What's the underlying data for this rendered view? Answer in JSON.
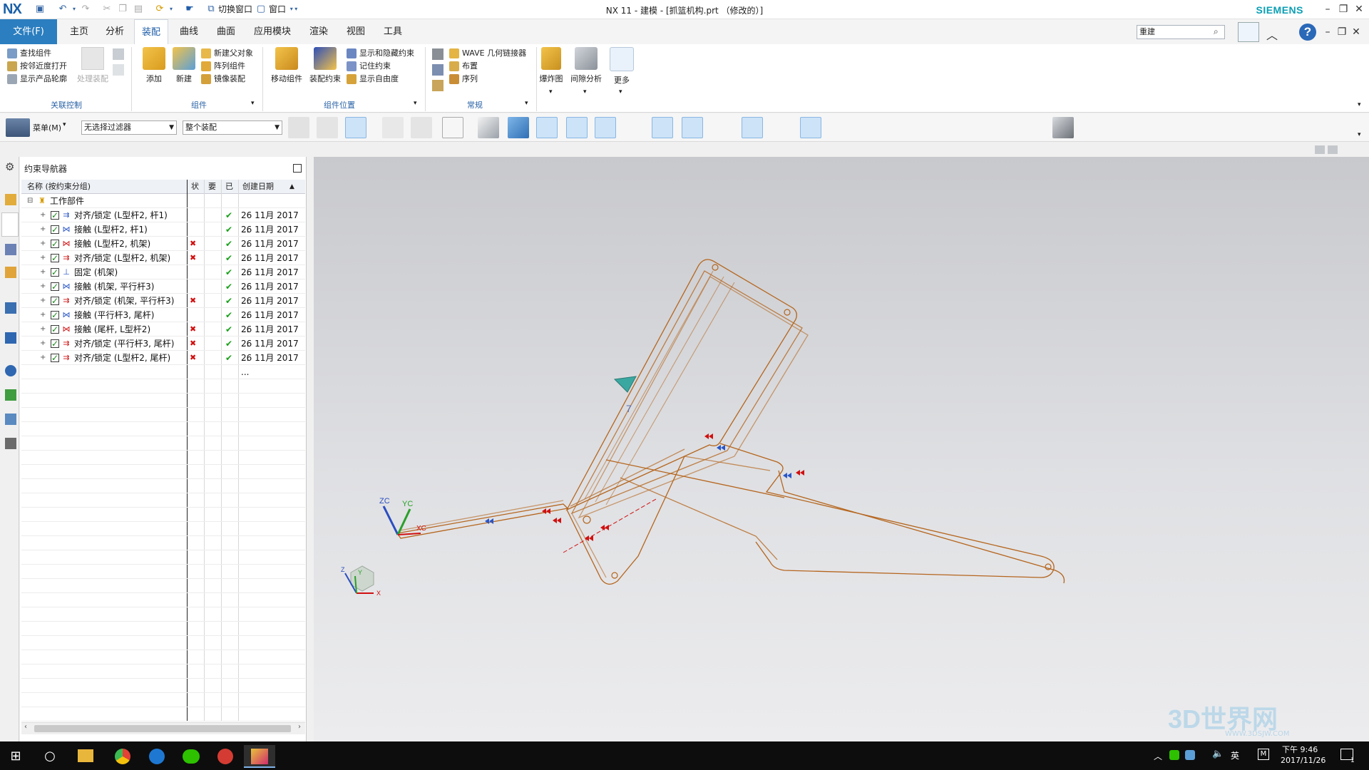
{
  "titlebar": {
    "logo": "NX",
    "switch_window": "切换窗口",
    "window": "窗口",
    "title": "NX 11 - 建模 - [抓篮机构.prt （修改的）]",
    "brand": "SIEMENS"
  },
  "tabs": {
    "file": "文件(F)",
    "items": [
      "主页",
      "分析",
      "装配",
      "曲线",
      "曲面",
      "应用模块",
      "渲染",
      "视图",
      "工具"
    ],
    "active_index": 2
  },
  "command_search": {
    "value": "重建"
  },
  "ribbon": {
    "group1": {
      "label": "关联控制",
      "items": [
        "查找组件",
        "按邻近度打开",
        "显示产品轮廓"
      ],
      "disabled_item": "处理装配"
    },
    "group2": {
      "label": "组件",
      "add": "添加",
      "new": "新建",
      "items": [
        "新建父对象",
        "阵列组件",
        "镜像装配"
      ]
    },
    "group3": {
      "label": "组件位置",
      "move": "移动组件",
      "constraint": "装配约束",
      "items": [
        "显示和隐藏约束",
        "记住约束",
        "显示自由度"
      ]
    },
    "group4": {
      "label": "常规",
      "items": [
        "WAVE 几何链接器",
        "布置",
        "序列"
      ]
    },
    "group5": {
      "exploded": "爆炸图",
      "clearance": "间隙分析",
      "more": "更多"
    }
  },
  "toolbar2": {
    "menu": "菜单(M)",
    "filter": "无选择过滤器",
    "scope": "整个装配"
  },
  "navigator": {
    "title": "约束导航器",
    "columns": [
      "名称 (按约束分组)",
      "状",
      "要",
      "已",
      "创建日期"
    ],
    "root": "工作部件",
    "rows": [
      {
        "label": "对齐/锁定 (L型杆2, 杆1)",
        "status": "",
        "date": "26 11月 2017 ..."
      },
      {
        "label": "接触 (L型杆2, 杆1)",
        "status": "",
        "date": "26 11月 2017 ..."
      },
      {
        "label": "接触 (L型杆2, 机架)",
        "status": "✖",
        "date": "26 11月 2017 ..."
      },
      {
        "label": "对齐/锁定 (L型杆2, 机架)",
        "status": "✖",
        "date": "26 11月 2017 ..."
      },
      {
        "label": "固定 (机架)",
        "status": "",
        "date": "26 11月 2017 ..."
      },
      {
        "label": "接触 (机架, 平行杆3)",
        "status": "",
        "date": "26 11月 2017 ..."
      },
      {
        "label": "对齐/锁定 (机架, 平行杆3)",
        "status": "✖",
        "date": "26 11月 2017 ..."
      },
      {
        "label": "接触 (平行杆3, 尾杆)",
        "status": "",
        "date": "26 11月 2017 ..."
      },
      {
        "label": "接触 (尾杆, L型杆2)",
        "status": "✖",
        "date": "26 11月 2017 ..."
      },
      {
        "label": "对齐/锁定 (平行杆3, 尾杆)",
        "status": "✖",
        "date": "26 11月 2017 ..."
      },
      {
        "label": "对齐/锁定 (L型杆2, 尾杆)",
        "status": "✖",
        "date": "26 11月 2017 ..."
      }
    ]
  },
  "viewport": {
    "axes": {
      "zc": "ZC",
      "yc": "YC",
      "xc": "XC"
    },
    "triad": {
      "z": "Z",
      "y": "Y",
      "x": "X"
    },
    "part_label": "7"
  },
  "taskbar": {
    "time": "下午 9:46",
    "date": "2017/11/26",
    "ime": "英",
    "notif_count": "1"
  },
  "watermark": "3D世界网",
  "watermark_sub": "WWW.3DSJW.COM",
  "colors": {
    "accent": "#2b7ebf",
    "model_edge": "#b5651d",
    "constraint_red": "#d01010",
    "constraint_blue": "#2a56c6",
    "check_green": "#19a019"
  }
}
